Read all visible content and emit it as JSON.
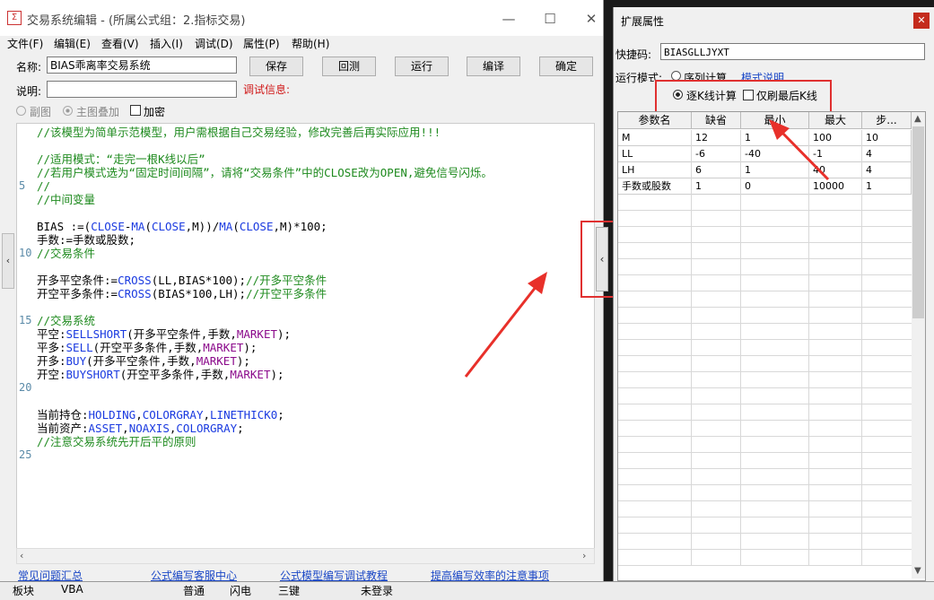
{
  "editor": {
    "window_title": "交易系统编辑 - (所属公式组：2.指标交易)",
    "app_icon": "formula-app-icon",
    "menu": [
      "文件(F)",
      "编辑(E)",
      "查看(V)",
      "插入(I)",
      "调试(D)",
      "属性(P)",
      "帮助(H)"
    ],
    "name_label": "名称:",
    "name_value": "BIAS乖离率交易系统",
    "desc_label": "说明:",
    "desc_value": "",
    "debug_info_label": "调试信息:",
    "buttons": {
      "save": "保存",
      "back": "回测",
      "run": "运行",
      "compile": "编译",
      "ok": "确定"
    },
    "radio_sub": "副图",
    "radio_main": "主图叠加",
    "check_encrypt": "加密",
    "line_numbers": [
      "5",
      "10",
      "15",
      "20",
      "25"
    ],
    "code_lines": [
      [
        {
          "t": "//该模型为简单示范模型，用户需根据自己交易经验，修改完善后再实际应用!!!",
          "c": "cm"
        }
      ],
      [],
      [
        {
          "t": "//适用模式：“走完一根K线以后”",
          "c": "cm"
        }
      ],
      [
        {
          "t": "//若用户模式选为“固定时间间隔”，请将“交易条件”中的CLOSE改为OPEN,避免信号闪烁。",
          "c": "cm"
        }
      ],
      [
        {
          "t": "//",
          "c": "cm"
        }
      ],
      [
        {
          "t": "//中间变量",
          "c": "cm"
        }
      ],
      [],
      [
        {
          "t": "BIAS :=(",
          "c": "bk"
        },
        {
          "t": "CLOSE",
          "c": "kw"
        },
        {
          "t": "-",
          "c": "bk"
        },
        {
          "t": "MA",
          "c": "kw"
        },
        {
          "t": "(",
          "c": "bk"
        },
        {
          "t": "CLOSE",
          "c": "kw"
        },
        {
          "t": ",M))/",
          "c": "bk"
        },
        {
          "t": "MA",
          "c": "kw"
        },
        {
          "t": "(",
          "c": "bk"
        },
        {
          "t": "CLOSE",
          "c": "kw"
        },
        {
          "t": ",M)*100;",
          "c": "bk"
        }
      ],
      [
        {
          "t": "手数:=手数或股数;",
          "c": "bk"
        }
      ],
      [
        {
          "t": "//交易条件",
          "c": "cm"
        }
      ],
      [],
      [
        {
          "t": "开多平空条件:=",
          "c": "bk"
        },
        {
          "t": "CROSS",
          "c": "kw"
        },
        {
          "t": "(LL,BIAS*100);",
          "c": "bk"
        },
        {
          "t": "//开多平空条件",
          "c": "cm"
        }
      ],
      [
        {
          "t": "开空平多条件:=",
          "c": "bk"
        },
        {
          "t": "CROSS",
          "c": "kw"
        },
        {
          "t": "(BIAS*100,LH);",
          "c": "bk"
        },
        {
          "t": "//开空平多条件",
          "c": "cm"
        }
      ],
      [],
      [
        {
          "t": "//交易系统",
          "c": "cm"
        }
      ],
      [
        {
          "t": "平空:",
          "c": "bk"
        },
        {
          "t": "SELLSHORT",
          "c": "kw"
        },
        {
          "t": "(开多平空条件,手数,",
          "c": "bk"
        },
        {
          "t": "MARKET",
          "c": "pu"
        },
        {
          "t": ");",
          "c": "bk"
        }
      ],
      [
        {
          "t": "平多:",
          "c": "bk"
        },
        {
          "t": "SELL",
          "c": "kw"
        },
        {
          "t": "(开空平多条件,手数,",
          "c": "bk"
        },
        {
          "t": "MARKET",
          "c": "pu"
        },
        {
          "t": ");",
          "c": "bk"
        }
      ],
      [
        {
          "t": "开多:",
          "c": "bk"
        },
        {
          "t": "BUY",
          "c": "kw"
        },
        {
          "t": "(开多平空条件,手数,",
          "c": "bk"
        },
        {
          "t": "MARKET",
          "c": "pu"
        },
        {
          "t": ");",
          "c": "bk"
        }
      ],
      [
        {
          "t": "开空:",
          "c": "bk"
        },
        {
          "t": "BUYSHORT",
          "c": "kw"
        },
        {
          "t": "(开空平多条件,手数,",
          "c": "bk"
        },
        {
          "t": "MARKET",
          "c": "pu"
        },
        {
          "t": ");",
          "c": "bk"
        }
      ],
      [],
      [],
      [
        {
          "t": "当前持仓:",
          "c": "bk"
        },
        {
          "t": "HOLDING",
          "c": "kw"
        },
        {
          "t": ",",
          "c": "bk"
        },
        {
          "t": "COLORGRAY",
          "c": "kw"
        },
        {
          "t": ",",
          "c": "bk"
        },
        {
          "t": "LINETHICK0",
          "c": "kw"
        },
        {
          "t": ";",
          "c": "bk"
        }
      ],
      [
        {
          "t": "当前资产:",
          "c": "bk"
        },
        {
          "t": "ASSET",
          "c": "kw"
        },
        {
          "t": ",",
          "c": "bk"
        },
        {
          "t": "NOAXIS",
          "c": "kw"
        },
        {
          "t": ",",
          "c": "bk"
        },
        {
          "t": "COLORGRAY",
          "c": "kw"
        },
        {
          "t": ";",
          "c": "bk"
        }
      ],
      [
        {
          "t": "//注意交易系统先开后平的原则",
          "c": "cm"
        }
      ]
    ],
    "bottom_links": [
      "常见问题汇总",
      "公式编写客服中心",
      "公式模型编写调试教程",
      "提高编写效率的注意事项"
    ]
  },
  "panel": {
    "title": "扩展属性",
    "shortcut_label": "快捷码:",
    "shortcut_value": "BIASGLLJYXT",
    "run_mode_label": "运行模式:",
    "run_mode_option": "序列计算",
    "mode_help_link": "模式说明",
    "option_per_k": "逐K线计算",
    "option_last_k": "仅刷最后K线",
    "grid_headers": [
      "参数名",
      "缺省",
      "最小",
      "最大",
      "步..."
    ],
    "grid_rows": [
      [
        "M",
        "12",
        "1",
        "100",
        "10"
      ],
      [
        "LL",
        "-6",
        "-40",
        "-1",
        "4"
      ],
      [
        "LH",
        "6",
        "1",
        "40",
        "4"
      ],
      [
        "手数或股数",
        "1",
        "0",
        "10000",
        "1"
      ]
    ]
  },
  "taskbar": [
    "板块",
    "VBA",
    "普通",
    "闪电",
    "三键",
    "未登录"
  ],
  "colors": {
    "accent_red": "#e03030",
    "comment_green": "#1e8a1e",
    "keyword_blue": "#1a3ae0",
    "link_blue": "#1a47c6"
  }
}
